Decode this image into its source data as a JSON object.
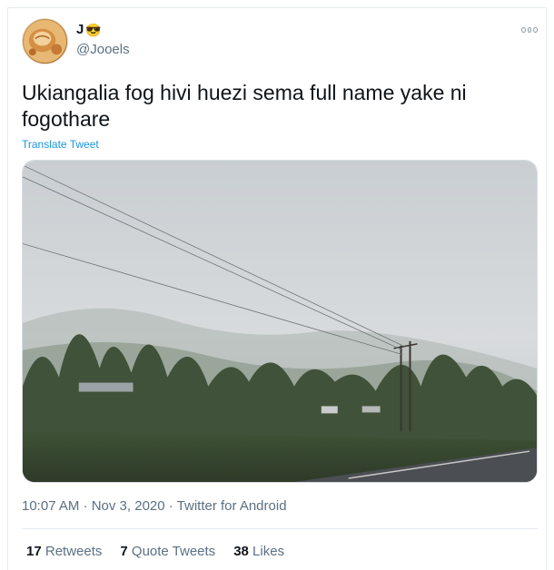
{
  "author": {
    "display_name": "J",
    "display_emoji": "😎",
    "handle": "@Jooels"
  },
  "tweet": {
    "text": "Ukiangalia fog hivi huezi sema full name yake ni fogothare",
    "translate_label": "Translate Tweet",
    "meta": "10:07 AM · Nov 3, 2020 · Twitter for Android"
  },
  "stats": {
    "retweets_count": "17",
    "retweets_label": "Retweets",
    "quotes_count": "7",
    "quotes_label": "Quote Tweets",
    "likes_count": "38",
    "likes_label": "Likes"
  },
  "icons": {
    "more": "more-options-icon"
  },
  "colors": {
    "link": "#1b95e0",
    "secondary_text": "#5b7083",
    "primary_text": "#0f1419"
  }
}
